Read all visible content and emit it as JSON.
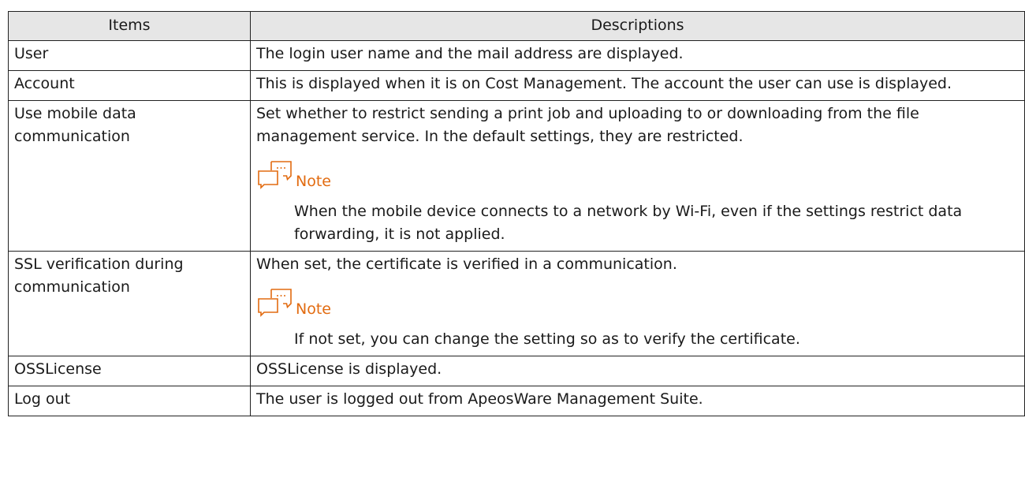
{
  "table": {
    "headers": [
      "Items",
      "Descriptions"
    ],
    "rows": [
      {
        "item": "User",
        "description": "The login user name and the mail address are displayed."
      },
      {
        "item": "Account",
        "description": "This is displayed when it is on Cost Management. The account the user can use is displayed."
      },
      {
        "item": "Use mobile data communication",
        "description": "Set whether to restrict sending a print job and uploading to or downloading from the file management service. In the default settings, they are restricted.",
        "note_label": "Note",
        "note_text": "When the mobile device connects to a network by Wi-Fi, even if the settings restrict data forwarding, it is not applied."
      },
      {
        "item": "SSL verification during communication",
        "description": "When set, the certificate is verified in a communication.",
        "note_label": "Note",
        "note_text": "If not set, you can change the setting so as to verify the certificate."
      },
      {
        "item": "OSSLicense",
        "description": "OSSLicense is displayed."
      },
      {
        "item": "Log out",
        "description": "The user is logged out from ApeosWare Management Suite."
      }
    ]
  },
  "note_icon": "speech-bubbles-note-icon",
  "colors": {
    "header_bg": "#e6e6e6",
    "note_accent": "#e26b10",
    "border": "#222222"
  }
}
